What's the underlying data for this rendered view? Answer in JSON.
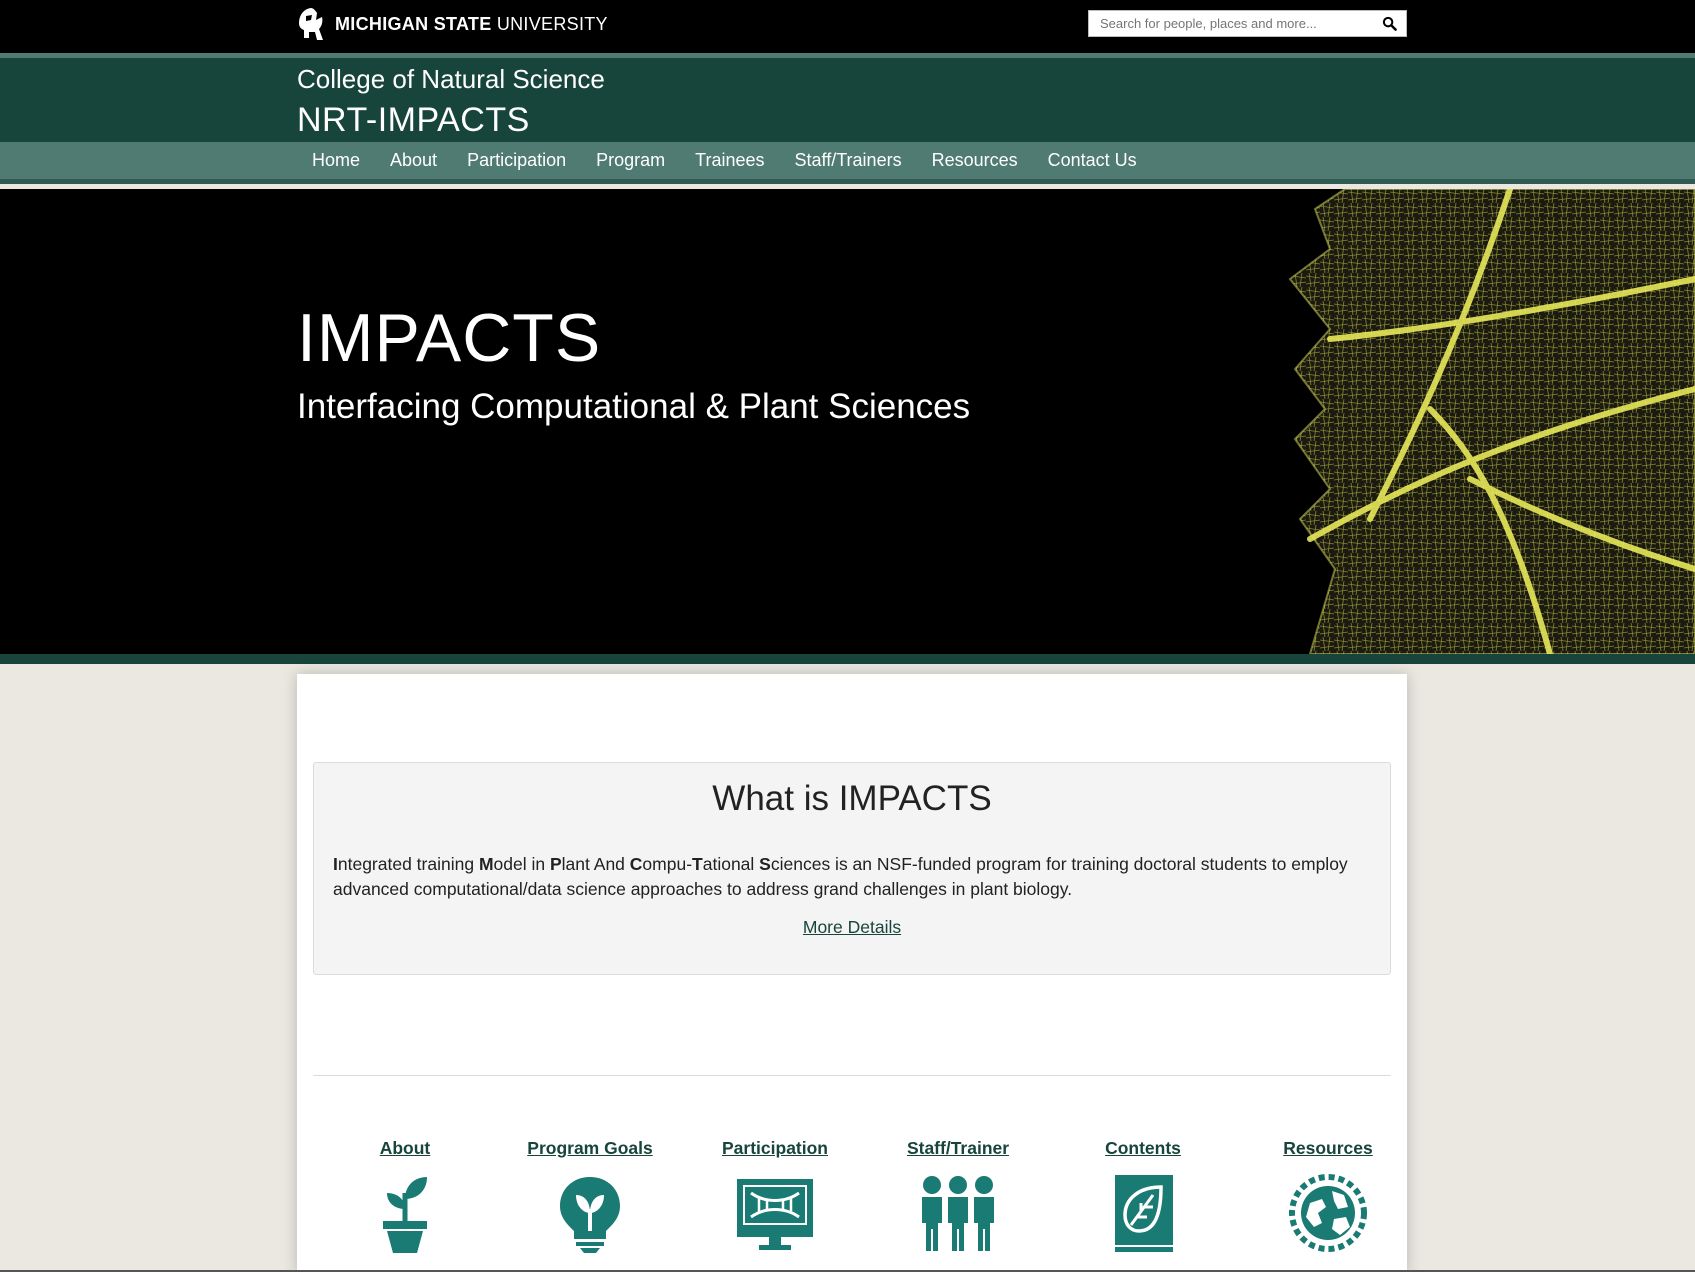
{
  "header": {
    "university_bold": "MICHIGAN STATE",
    "university_light": " UNIVERSITY",
    "search_placeholder": "Search for people, places and more..."
  },
  "masthead": {
    "college": "College of Natural Science",
    "site_title": "NRT-IMPACTS"
  },
  "nav": {
    "items": [
      "Home",
      "About",
      "Participation",
      "Program",
      "Trainees",
      "Staff/Trainers",
      "Resources",
      "Contact Us"
    ]
  },
  "hero": {
    "title": "IMPACTS",
    "subtitle": "Interfacing Computational & Plant Sciences"
  },
  "intro": {
    "heading": "What is IMPACTS",
    "segments": [
      {
        "b": "I",
        "t": "ntegrated training "
      },
      {
        "b": "M",
        "t": "odel in "
      },
      {
        "b": "P",
        "t": "lant And "
      },
      {
        "b": "C",
        "t": "ompu-"
      },
      {
        "b": "T",
        "t": "ational "
      },
      {
        "b": "S",
        "t": "ciences is an NSF-funded program for training doctoral students to employ advanced computational/data science approaches to address grand challenges in plant biology."
      }
    ],
    "more_link": "More Details"
  },
  "features": [
    {
      "label": "About",
      "icon": "seedling-pot-icon"
    },
    {
      "label": "Program Goals",
      "icon": "lightbulb-leaf-icon"
    },
    {
      "label": "Participation",
      "icon": "dna-monitor-icon"
    },
    {
      "label": "Staff/Trainer ",
      "icon": "people-group-icon"
    },
    {
      "label": "Contents",
      "icon": "leaf-book-icon"
    },
    {
      "label": "Resources",
      "icon": "globe-gear-icon"
    }
  ],
  "colors": {
    "msu_green": "#18453b",
    "nav_green": "#4f7b72",
    "icon_teal": "#1a7a74",
    "page_bg": "#ebe8e1"
  }
}
